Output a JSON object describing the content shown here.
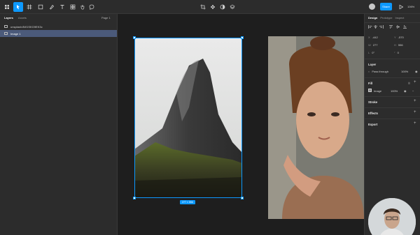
{
  "toolbar": {
    "share_label": "Share",
    "zoom_label": "106%",
    "tools": [
      "menu-icon",
      "move-icon",
      "frame-icon",
      "shape-icon",
      "pen-icon",
      "text-icon",
      "resources-icon",
      "hand-icon",
      "comment-icon"
    ],
    "center_tools": [
      "crop-icon",
      "component-icon",
      "contrast-icon",
      "layers-stack-icon"
    ],
    "accent_color": "#0d99ff"
  },
  "left_panel": {
    "tabs": [
      "Layers",
      "Assets"
    ],
    "page_label": "Page 1",
    "layers": [
      {
        "name": "unsplash:8W1SKG9EK3c",
        "selected": false
      },
      {
        "name": "Image 1",
        "selected": true
      }
    ]
  },
  "canvas": {
    "size_label": "277 × 556"
  },
  "right_panel": {
    "tabs": [
      "Design",
      "Prototype",
      "Inspect"
    ],
    "position": {
      "x_label": "X",
      "x_value": "-442",
      "y_label": "Y",
      "y_value": "-570"
    },
    "dimensions": {
      "w_label": "W",
      "w_value": "277",
      "h_label": "H",
      "h_value": "556"
    },
    "rotation": {
      "label": "L",
      "value": "0°"
    },
    "corner_radius": {
      "value": "0"
    },
    "layer_section": {
      "title": "Layer",
      "blend_mode": "Pass through",
      "opacity": "100%"
    },
    "fill_section": {
      "title": "Fill",
      "fill_type": "Image",
      "fill_opacity": "100%"
    },
    "stroke_title": "Stroke",
    "effects_title": "Effects",
    "export_title": "Export"
  }
}
